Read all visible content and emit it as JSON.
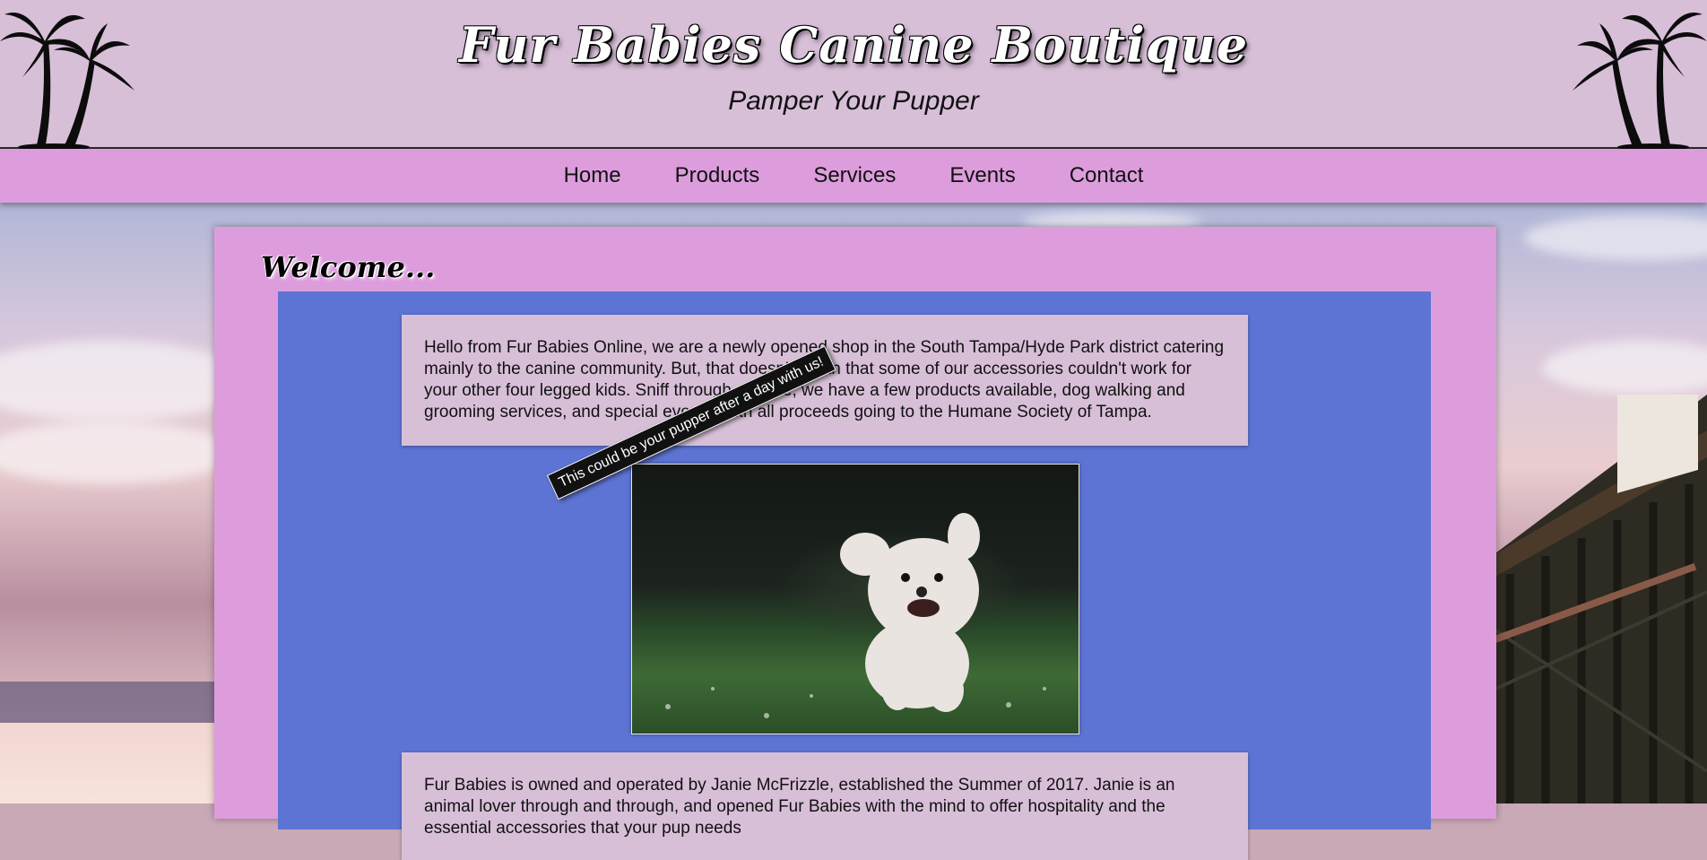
{
  "header": {
    "title": "Fur Babies Canine Boutique",
    "tagline": "Pamper Your Pupper"
  },
  "nav": {
    "items": [
      {
        "label": "Home"
      },
      {
        "label": "Products"
      },
      {
        "label": "Services"
      },
      {
        "label": "Events"
      },
      {
        "label": "Contact"
      }
    ]
  },
  "main": {
    "heading": "Welcome...",
    "intro": "Hello from Fur Babies Online, we are a newly opened shop in the South Tampa/Hyde Park district catering mainly to the canine community. But, that doesn't mean that some of our accessories couldn't work for your other four legged kids. Sniff through our site, we have a few products available, dog walking and grooming services, and special events, with all proceeds going to the Humane Society of Tampa.",
    "photo_caption": "This could be your pupper after a day with us!",
    "about": "Fur Babies is owned and operated by Janie McFrizzle, established the Summer of 2017. Janie is an animal lover through and through, and opened Fur Babies with the mind to offer hospitality and the essential accessories that your pup needs"
  },
  "colors": {
    "header_bg": "#d8bfd8",
    "nav_bg": "#dd9ddd",
    "inner_bg": "#5d74d4"
  },
  "icons": {
    "palm_left": "palm-trees-icon",
    "palm_right": "palm-trees-icon"
  }
}
